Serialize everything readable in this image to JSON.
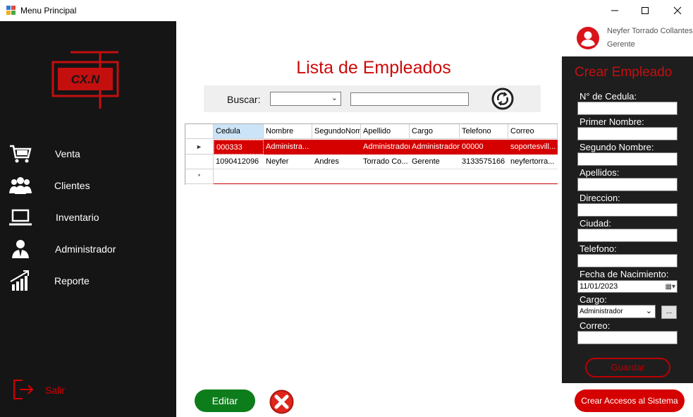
{
  "window": {
    "title": "Menu Principal",
    "controls": [
      "minimize",
      "maximize",
      "close"
    ]
  },
  "sidebar": {
    "logo_text": "CX.N",
    "items": [
      {
        "label": "Venta",
        "icon": "cart-icon"
      },
      {
        "label": "Clientes",
        "icon": "users-icon"
      },
      {
        "label": "Inventario",
        "icon": "laptop-icon"
      },
      {
        "label": "Administrador",
        "icon": "admin-user-icon"
      },
      {
        "label": "Reporte",
        "icon": "chart-bars-icon"
      }
    ],
    "exit_label": "Salir"
  },
  "main": {
    "title": "Lista de Empleados",
    "search": {
      "label": "Buscar:",
      "select_value": "",
      "input_value": ""
    },
    "grid": {
      "columns": [
        "Cedula",
        "Nombre",
        "SegundoNom",
        "Apellido",
        "Cargo",
        "Telefono",
        "Correo"
      ],
      "rows": [
        [
          "000333",
          "Administra...",
          "",
          "Administrador",
          "Administrador",
          "00000",
          "soportesvill..."
        ],
        [
          "1090412096",
          "Neyfer",
          "Andres",
          "Torrado Co...",
          "Gerente",
          "3133575166",
          "neyfertorra..."
        ]
      ],
      "new_row_marker": "*"
    },
    "edit_label": "Editar"
  },
  "user": {
    "name": "Neyfer Torrado Collantes",
    "role": "Gerente"
  },
  "form": {
    "title": "Crear Empleado",
    "labels": {
      "cedula": "N° de Cedula:",
      "primer_nombre": "Primer Nombre:",
      "segundo_nombre": "Segundo Nombre:",
      "apellidos": "Apellidos:",
      "direccion": "Direccion:",
      "ciudad": "Ciudad:",
      "telefono": "Telefono:",
      "fecha": "Fecha de Nacimiento:",
      "cargo": "Cargo:",
      "correo": "Correo:"
    },
    "fecha_value": "11/01/2023",
    "cargo_value": "Administrador",
    "dots_label": "...",
    "save_label": "Guardar"
  },
  "accesos_label": "Crear Accesos al Sistema",
  "colors": {
    "accent_red": "#d50000",
    "sidebar_bg": "#151516",
    "panel_bg": "#1e1e1f",
    "edit_green": "#0d7d1c"
  }
}
